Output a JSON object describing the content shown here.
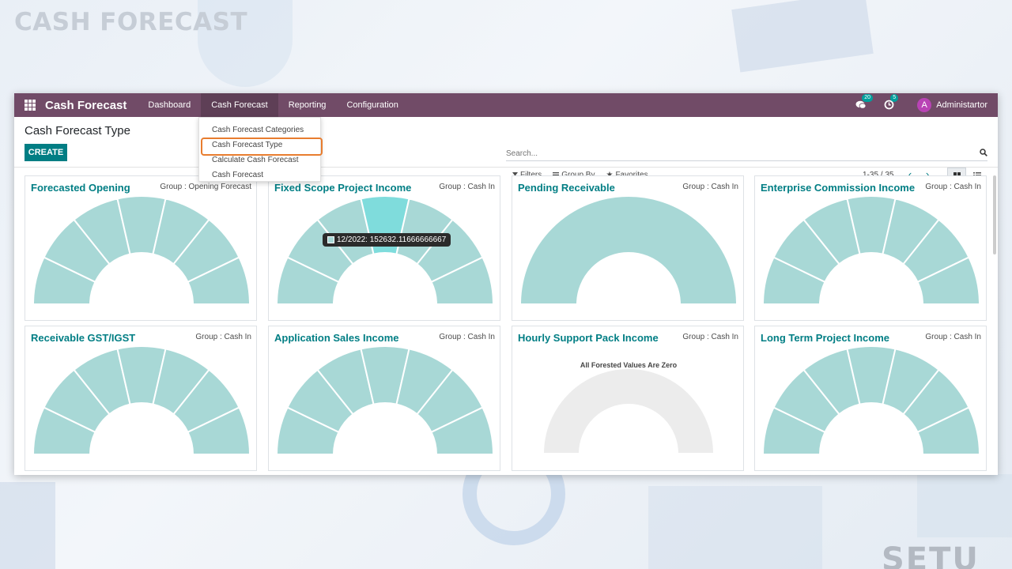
{
  "background": {
    "title": "CASH FORECAST",
    "brand": "SETU"
  },
  "navbar": {
    "app_name": "Cash Forecast",
    "menu": [
      "Dashboard",
      "Cash Forecast",
      "Reporting",
      "Configuration"
    ],
    "messages_count": "20",
    "activities_count": "5",
    "avatar_letter": "A",
    "user": "Administartor",
    "color": "#714b67"
  },
  "control": {
    "page_title": "Cash Forecast Type",
    "create_label": "CREATE",
    "search_placeholder": "Search...",
    "filters": "Filters",
    "group_by": "Group By",
    "favorites": "Favorites",
    "pager": "1-35 / 35"
  },
  "dropdown": {
    "items": [
      "Cash Forecast Categories",
      "Cash Forecast Type",
      "Calculate Cash Forecast",
      "Cash Forecast"
    ],
    "highlighted": "Cash Forecast Type"
  },
  "cards": [
    {
      "title": "Forecasted Opening",
      "group": "Group : Opening Forecast"
    },
    {
      "title": "Fixed Scope Project Income",
      "group": "Group : Cash In"
    },
    {
      "title": "Pending Receivable",
      "group": "Group : Cash In"
    },
    {
      "title": "Enterprise Commission Income",
      "group": "Group : Cash In"
    },
    {
      "title": "Receivable GST/IGST",
      "group": "Group : Cash In"
    },
    {
      "title": "Application Sales Income",
      "group": "Group : Cash In"
    },
    {
      "title": "Hourly Support Pack Income",
      "group": "Group : Cash In"
    },
    {
      "title": "Long Term Project Income",
      "group": "Group : Cash In"
    }
  ],
  "tooltip": "12/2022: 152632.11666666667",
  "zero_message": "All Forested Values Are Zero",
  "colors": {
    "accent": "#017e84",
    "gauge": "#a8d8d6",
    "gauge_highlight": "#7fdcdc",
    "gauge_zero": "#ececec"
  }
}
